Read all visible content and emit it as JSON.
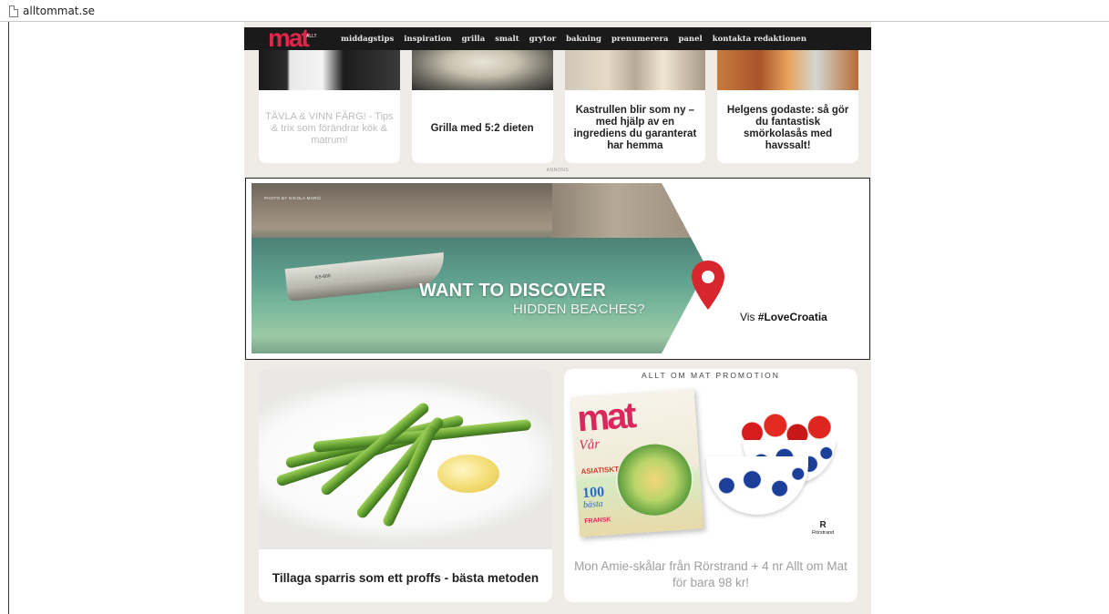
{
  "browser": {
    "url": "alltommat.se"
  },
  "nav": {
    "logo": "mat",
    "logo_stamp": "ALLT OM",
    "items": [
      "middagstips",
      "inspiration",
      "grilla",
      "smalt",
      "grytor",
      "bakning",
      "prenumerera",
      "panel",
      "kontakta redaktionen"
    ]
  },
  "top_cards": [
    {
      "title": "TÄVLA & VINN FÄRG! - Tips & trix som förändrar kök & matrum!",
      "style": "light"
    },
    {
      "title": "Grilla med 5:2 dieten"
    },
    {
      "title": "Kastrullen blir som ny – med hjälp av en ingrediens du garanterat har hemma"
    },
    {
      "title": "Helgens godaste: så gör du fantastisk smörkolasås med havssalt!"
    }
  ],
  "annons_label": "ANNONS",
  "ad": {
    "credit": "PHOTO BY NIKOLA MARIĆ",
    "boat_number": "KS-600",
    "headline": "WANT TO DISCOVER",
    "subline": "HIDDEN BEACHES?",
    "cta_prefix": "Vis ",
    "cta_hashtag": "#LoveCroatia",
    "pin_color": "#d7262d"
  },
  "bottom_cards": {
    "left": {
      "title": "Tillaga sparris som ett proffs - bästa metoden"
    },
    "right": {
      "label": "ALLT OM MAT PROMOTION",
      "title": "Mon Amie-skålar från Rörstrand + 4 nr Allt om Mat för bara 98 kr!",
      "magazine": {
        "logo": "mat",
        "var": "Vår",
        "line1": "ASIATISKT",
        "hundred": "100",
        "basta": "bästa",
        "fransk": "FRANSK"
      },
      "brand": {
        "mark": "R",
        "name": "Rörstrand"
      }
    }
  },
  "colors": {
    "accent": "#e0264a",
    "nav_bg": "#1a1a1a",
    "site_bg": "#efece8"
  }
}
